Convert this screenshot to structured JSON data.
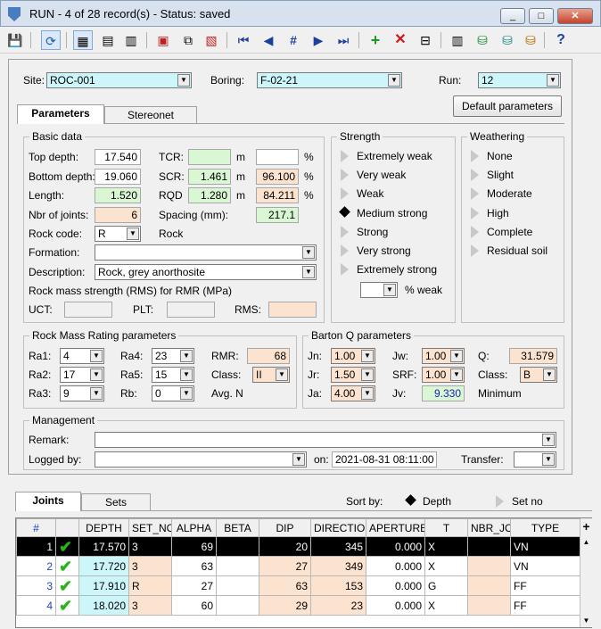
{
  "window": {
    "title": "RUN - 4 of 28 record(s) - Status: saved",
    "min": "_",
    "max": "□",
    "close": "✕"
  },
  "toolbar": {
    "help": "?"
  },
  "header": {
    "site_label": "Site:",
    "site": "ROC-001",
    "boring_label": "Boring:",
    "boring": "F-02-21",
    "run_label": "Run:",
    "run": "12",
    "default_btn": "Default parameters"
  },
  "tabs": {
    "parameters": "Parameters",
    "stereonet": "Stereonet"
  },
  "basic": {
    "title": "Basic data",
    "top_depth_label": "Top depth:",
    "top_depth": "17.540",
    "bottom_depth_label": "Bottom depth:",
    "bottom_depth": "19.060",
    "length_label": "Length:",
    "length": "1.520",
    "nbr_joints_label": "Nbr of joints:",
    "nbr_joints": "6",
    "tcr_label": "TCR:",
    "tcr": "",
    "tcr_unit": "m",
    "tcr_pct": "",
    "scr_label": "SCR:",
    "scr": "1.461",
    "scr_unit": "m",
    "scr_pct": "96.100",
    "rqd_label": "RQD",
    "rqd": "1.280",
    "rqd_unit": "m",
    "rqd_pct": "84.211",
    "pct": "%",
    "spacing_label": "Spacing (mm):",
    "spacing": "217.1",
    "rock_code_label": "Rock code:",
    "rock_code": "R",
    "rock_name": "Rock",
    "formation_label": "Formation:",
    "formation": "",
    "description_label": "Description:",
    "description": "Rock, grey anorthosite",
    "rms_title": "Rock mass strength (RMS) for RMR (MPa)",
    "ucs_label": "UCT:",
    "plt_label": "PLT:",
    "rms_label": "RMS:"
  },
  "strength": {
    "title": "Strength",
    "options": [
      "Extremely weak",
      "Very weak",
      "Weak",
      "Medium strong",
      "Strong",
      "Very strong",
      "Extremely strong"
    ],
    "selected": "Medium strong",
    "weak_label": "% weak"
  },
  "weathering": {
    "title": "Weathering",
    "options": [
      "None",
      "Slight",
      "Moderate",
      "High",
      "Complete",
      "Residual soil"
    ]
  },
  "rmr": {
    "title": "Rock Mass Rating parameters",
    "ra1_label": "Ra1:",
    "ra1": "4",
    "ra2_label": "Ra2:",
    "ra2": "17",
    "ra3_label": "Ra3:",
    "ra3": "9",
    "ra4_label": "Ra4:",
    "ra4": "23",
    "ra5_label": "Ra5:",
    "ra5": "15",
    "rb_label": "Rb:",
    "rb": "0",
    "rmr_label": "RMR:",
    "rmr": "68",
    "class_label": "Class:",
    "class": "II",
    "avg_label": "Avg. N"
  },
  "barton": {
    "title": "Barton Q parameters",
    "jn_label": "Jn:",
    "jn": "1.00",
    "jr_label": "Jr:",
    "jr": "1.50",
    "ja_label": "Ja:",
    "ja": "4.00",
    "jw_label": "Jw:",
    "jw": "1.00",
    "srf_label": "SRF:",
    "srf": "1.00",
    "jv_label": "Jv:",
    "jv": "9.330",
    "q_label": "Q:",
    "q": "31.579",
    "class_label": "Class:",
    "class": "B",
    "min_label": "Minimum"
  },
  "management": {
    "title": "Management",
    "remark_label": "Remark:",
    "remark": "",
    "logged_label": "Logged by:",
    "logged": "",
    "on_label": "on:",
    "on": "2021-08-31 08:11:00",
    "transfer_label": "Transfer:",
    "transfer": ""
  },
  "lower_tabs": {
    "joints": "Joints",
    "sets": "Sets",
    "sort_label": "Sort by:",
    "sort_depth": "Depth",
    "sort_set": "Set no"
  },
  "grid": {
    "columns": [
      "#",
      "",
      "DEPTH",
      "SET_NO",
      "ALPHA",
      "BETA",
      "DIP",
      "DIRECTION",
      "APERTURE",
      "T",
      "NBR_JO",
      "TYPE",
      "+"
    ],
    "rows": [
      {
        "n": "1",
        "depth": "17.570",
        "set": "3",
        "alpha": "69",
        "beta": "",
        "dip": "20",
        "dir": "345",
        "ap": "0.000",
        "t": "X",
        "nbr": "",
        "type": "VN"
      },
      {
        "n": "2",
        "depth": "17.720",
        "set": "3",
        "alpha": "63",
        "beta": "",
        "dip": "27",
        "dir": "349",
        "ap": "0.000",
        "t": "X",
        "nbr": "",
        "type": "VN"
      },
      {
        "n": "3",
        "depth": "17.910",
        "set": "R",
        "alpha": "27",
        "beta": "",
        "dip": "63",
        "dir": "153",
        "ap": "0.000",
        "t": "G",
        "nbr": "",
        "type": "FF"
      },
      {
        "n": "4",
        "depth": "18.020",
        "set": "3",
        "alpha": "60",
        "beta": "",
        "dip": "29",
        "dir": "23",
        "ap": "0.000",
        "t": "X",
        "nbr": "",
        "type": "FF"
      }
    ]
  }
}
